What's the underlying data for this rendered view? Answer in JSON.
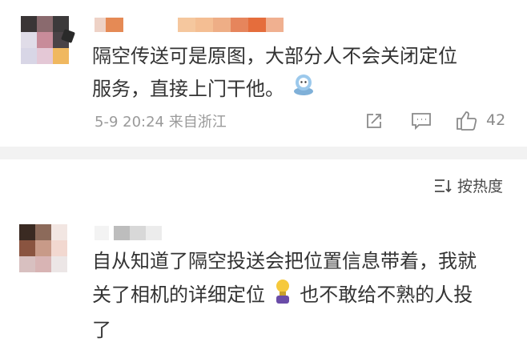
{
  "comments": [
    {
      "content_lines": [
        "隔空传送可是原图，大部分人不会关闭定位",
        "服务，直接上门干他。"
      ],
      "date": "5-9 20:24",
      "location": "来自浙江",
      "like_count": "42",
      "emoji": "astronaut-emoji"
    },
    {
      "content_lines": [
        "自从知道了隔空投送会把位置信息带着，我就",
        "关了相机的详细定位",
        "也不敢给不熟的人投",
        "了"
      ],
      "emoji": "lightbulb-emoji"
    }
  ],
  "sort": {
    "label": "按热度"
  },
  "colors": {
    "text": "#333333",
    "meta": "#9a9a9a",
    "divider": "#f2f2f2"
  }
}
